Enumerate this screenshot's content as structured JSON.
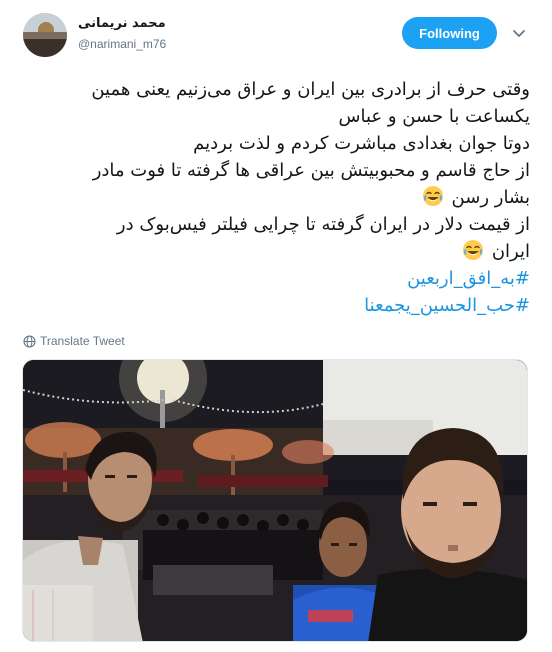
{
  "author": {
    "display_name": "محمد نریمانی",
    "handle": "@narimani_m76"
  },
  "follow_button": {
    "label": "Following"
  },
  "tweet": {
    "lines": [
      "وقتی حرف از برادری بین ایران و عراق می‌زنیم یعنی همین",
      "یکساعت با حسن و عباس",
      "دوتا جوان بغدادی مباشرت کردم و لذت بردیم",
      "از حاج قاسم و محبوبیتش بین عراقی ها گرفته تا فوت مادر",
      "بشار رسن",
      "از قیمت دلار در ایران گرفته تا چرایی فیلتر فیس‌بوک در",
      "ایران"
    ],
    "hashtags": [
      "#به_افق_اربعین",
      "#حب_الحسین_یجمعنا"
    ]
  },
  "translate_label": "Translate Tweet",
  "icons": {
    "caret": "chevron-down-icon",
    "translate": "globe-icon",
    "emoji": "face-with-tears-of-joy-icon"
  },
  "colors": {
    "accent": "#1da1f2",
    "hashtag": "#1b95e0",
    "muted": "#657786",
    "text": "#14171a"
  }
}
